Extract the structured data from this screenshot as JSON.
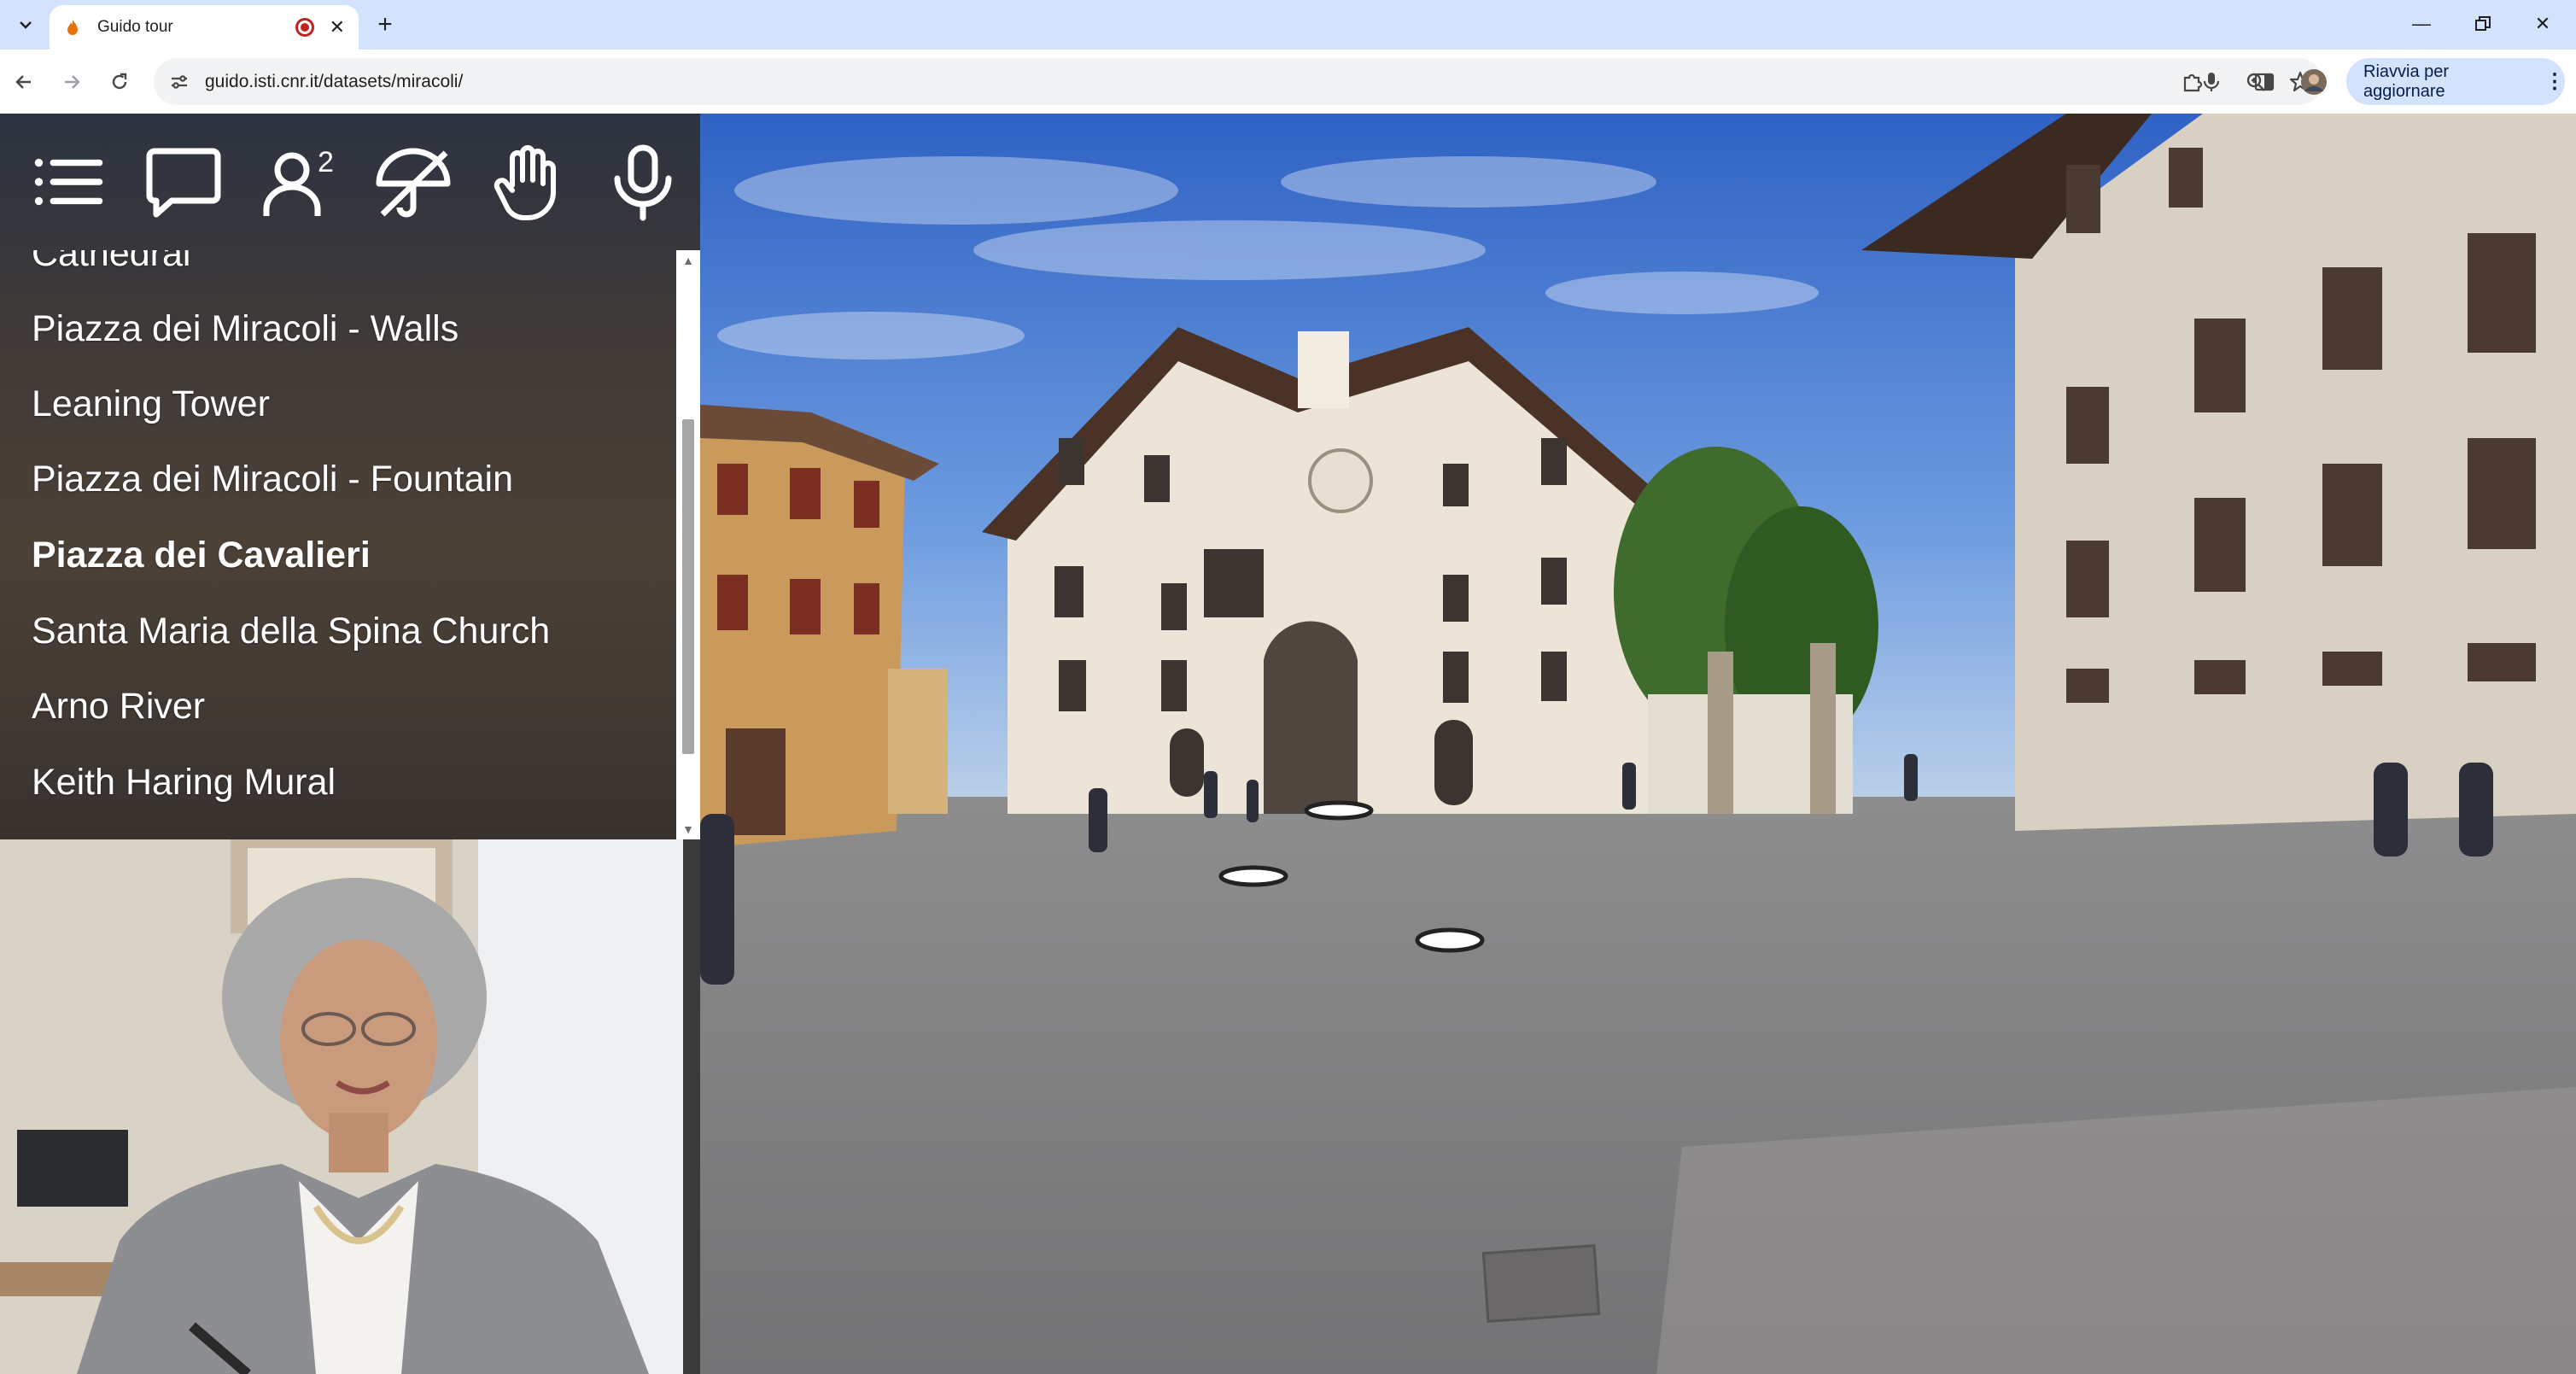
{
  "browser": {
    "tab_title": "Guido tour",
    "url": "guido.isti.cnr.it/datasets/miracoli/",
    "update_button": "Riavvia per aggiornare"
  },
  "toolbar_icons": [
    "menu-list-icon",
    "chat-bubble-icon",
    "users-icon",
    "umbrella-off-icon",
    "hand-icon",
    "microphone-icon"
  ],
  "users_superscript": "2",
  "menu": {
    "items": [
      {
        "label": "Cathedral",
        "active": false
      },
      {
        "label": "Piazza dei Miracoli - Walls",
        "active": false
      },
      {
        "label": "Leaning Tower",
        "active": false
      },
      {
        "label": "Piazza dei Miracoli - Fountain",
        "active": false
      },
      {
        "label": "Piazza dei Cavalieri",
        "active": true
      },
      {
        "label": "Santa Maria della Spina Church",
        "active": false
      },
      {
        "label": "Arno River",
        "active": false
      },
      {
        "label": "Keith Haring Mural",
        "active": false
      }
    ]
  },
  "colors": {
    "chrome_tab_strip": "#d3e3fd",
    "recording_indicator": "#c5221f",
    "menu_text": "#ffffff"
  }
}
